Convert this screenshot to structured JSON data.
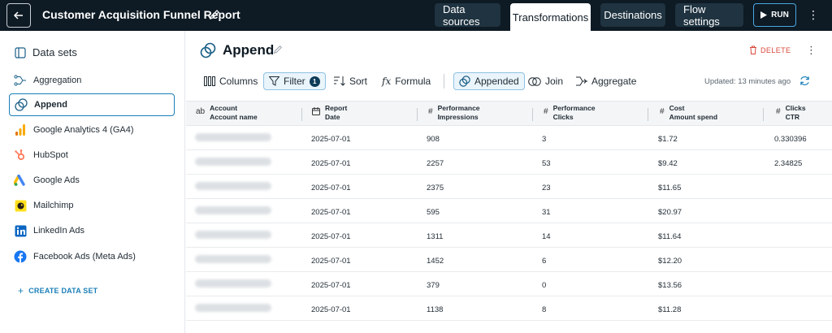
{
  "header": {
    "title": "Customer Acquisition Funnel Report",
    "nav": {
      "data_sources": "Data sources",
      "transformations": "Transformations",
      "destinations": "Destinations",
      "flow_settings": "Flow settings"
    },
    "run_label": "RUN",
    "accent": "#1a7fb8",
    "bar_color": "#0e1a24"
  },
  "sidebar": {
    "heading": "Data sets",
    "items": [
      {
        "label": "Aggregation",
        "icon": "aggregation-icon"
      },
      {
        "label": "Append",
        "icon": "append-icon",
        "active": true
      },
      {
        "label": "Google Analytics 4 (GA4)",
        "icon": "google-analytics-icon"
      },
      {
        "label": "HubSpot",
        "icon": "hubspot-icon"
      },
      {
        "label": "Google Ads",
        "icon": "google-ads-icon"
      },
      {
        "label": "Mailchimp",
        "icon": "mailchimp-icon"
      },
      {
        "label": "LinkedIn Ads",
        "icon": "linkedin-icon"
      },
      {
        "label": "Facebook Ads (Meta Ads)",
        "icon": "facebook-icon"
      }
    ],
    "create_label": "CREATE DATA SET"
  },
  "main": {
    "title": "Append",
    "delete_label": "DELETE",
    "toolbar": {
      "columns": "Columns",
      "filter": "Filter",
      "filter_count": "1",
      "sort": "Sort",
      "formula": "Formula",
      "appended": "Appended",
      "join": "Join",
      "aggregate": "Aggregate"
    },
    "updated": "Updated: 13 minutes ago"
  },
  "table": {
    "columns": [
      {
        "icon": "ab",
        "group": "Account",
        "name": "Account name"
      },
      {
        "icon": "calendar",
        "group": "Report",
        "name": "Date"
      },
      {
        "icon": "#",
        "group": "Performance",
        "name": "Impressions"
      },
      {
        "icon": "#",
        "group": "Performance",
        "name": "Clicks"
      },
      {
        "icon": "#",
        "group": "Cost",
        "name": "Amount spend"
      },
      {
        "icon": "#",
        "group": "Clicks",
        "name": "CTR"
      }
    ],
    "rows": [
      {
        "date": "2025-07-01",
        "impressions": "908",
        "clicks": "3",
        "spend": "$1.72",
        "ctr": "0.330396"
      },
      {
        "date": "2025-07-01",
        "impressions": "2257",
        "clicks": "53",
        "spend": "$9.42",
        "ctr": "2.34825"
      },
      {
        "date": "2025-07-01",
        "impressions": "2375",
        "clicks": "23",
        "spend": "$11.65",
        "ctr": ""
      },
      {
        "date": "2025-07-01",
        "impressions": "595",
        "clicks": "31",
        "spend": "$20.97",
        "ctr": ""
      },
      {
        "date": "2025-07-01",
        "impressions": "1311",
        "clicks": "14",
        "spend": "$11.64",
        "ctr": ""
      },
      {
        "date": "2025-07-01",
        "impressions": "1452",
        "clicks": "6",
        "spend": "$12.20",
        "ctr": ""
      },
      {
        "date": "2025-07-01",
        "impressions": "379",
        "clicks": "0",
        "spend": "$13.56",
        "ctr": ""
      },
      {
        "date": "2025-07-01",
        "impressions": "1138",
        "clicks": "8",
        "spend": "$11.28",
        "ctr": ""
      }
    ]
  }
}
